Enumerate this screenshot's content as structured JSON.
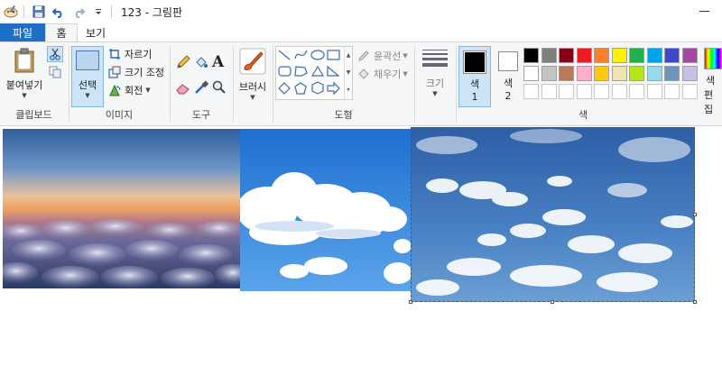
{
  "window": {
    "title": "123 - 그림판"
  },
  "tabs": [
    {
      "label": "파일"
    },
    {
      "label": "홈"
    },
    {
      "label": "보기"
    }
  ],
  "clipboard": {
    "group_label": "클립보드",
    "paste_label": "붙여넣기"
  },
  "image": {
    "group_label": "이미지",
    "select_label": "선택",
    "crop_label": "자르기",
    "resize_label": "크기 조정",
    "rotate_label": "회전"
  },
  "tools": {
    "group_label": "도구"
  },
  "brushes": {
    "label": "브러시"
  },
  "shapes": {
    "group_label": "도형",
    "outline_label": "윤곽선",
    "fill_label": "채우기"
  },
  "size": {
    "label": "크기"
  },
  "colors": {
    "group_label": "색",
    "color1_label": "색",
    "color1_num": "1",
    "color2_label": "색",
    "color2_num": "2",
    "edit_label_1": "색",
    "edit_label_2": "편집",
    "color1_value": "#000000",
    "color2_value": "#ffffff",
    "palette_row1": [
      "#000000",
      "#7f7f7f",
      "#880015",
      "#ed1c24",
      "#ff7f27",
      "#fff200",
      "#22b14c",
      "#00a2e8",
      "#3f48cc",
      "#a349a4"
    ],
    "palette_row2": [
      "#ffffff",
      "#c3c3c3",
      "#b97a57",
      "#ffaec9",
      "#ffc90e",
      "#efe4b0",
      "#b5e61d",
      "#99d9ea",
      "#7092be",
      "#c8bfe7"
    ],
    "palette_row3": [
      "#ffffff",
      "#ffffff",
      "#ffffff",
      "#ffffff",
      "#ffffff",
      "#ffffff",
      "#ffffff",
      "#ffffff",
      "#ffffff",
      "#ffffff"
    ]
  }
}
